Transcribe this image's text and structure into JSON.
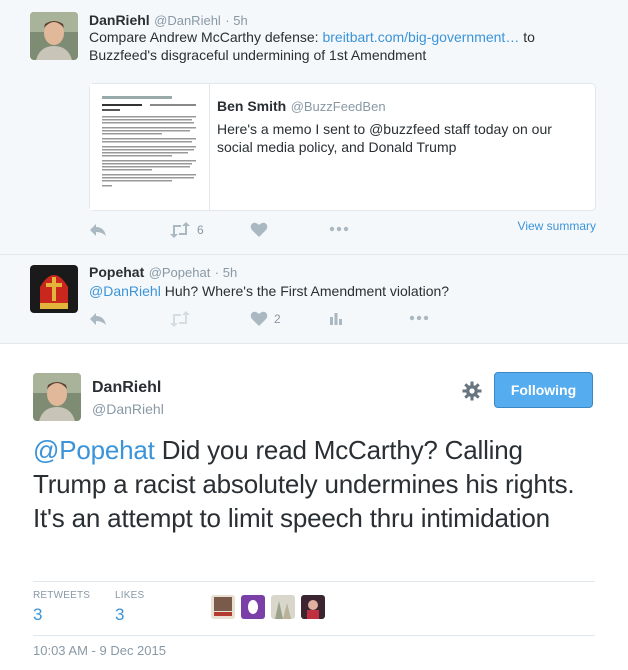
{
  "tweet1": {
    "name": "DanRiehl",
    "handle": "@DanRiehl",
    "time": "5h",
    "text_before": "Compare Andrew McCarthy defense: ",
    "link": "breitbart.com/big-government…",
    "text_after": " to Buzzfeed's disgraceful undermining of 1st Amendment",
    "card": {
      "name": "Ben Smith",
      "handle": "@BuzzFeedBen",
      "text": "Here's a memo I sent to @buzzfeed staff today on our social media policy, and Donald Trump"
    },
    "retweets": "6",
    "view_summary": "View summary"
  },
  "tweet2": {
    "name": "Popehat",
    "handle": "@Popehat",
    "time": "5h",
    "mention": "@DanRiehl",
    "text": " Huh? Where's the First Amendment violation?",
    "likes": "2"
  },
  "main": {
    "name": "DanRiehl",
    "handle": "@DanRiehl",
    "follow_label": "Following",
    "mention": "@Popehat",
    "text": " Did you read McCarthy? Calling Trump a racist absolutely undermines his rights. It's an attempt to limit speech thru intimidation",
    "retweets_label": "RETWEETS",
    "retweets": "3",
    "likes_label": "LIKES",
    "likes": "3",
    "timestamp": "10:03 AM - 9 Dec 2015"
  },
  "colors": {
    "link": "#3b94d9",
    "button": "#55acee",
    "muted": "#8899a6",
    "icon": "#aab8c2"
  },
  "icons": [
    "reply-icon",
    "retweet-icon",
    "like-icon",
    "more-icon",
    "analytics-icon",
    "gear-icon"
  ]
}
